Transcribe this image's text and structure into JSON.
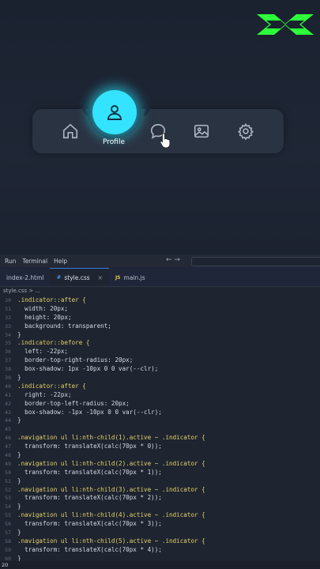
{
  "demo": {
    "nav_items": [
      {
        "name": "home",
        "label": "Home"
      },
      {
        "name": "profile",
        "label": "Profile"
      },
      {
        "name": "message",
        "label": "Message"
      },
      {
        "name": "photos",
        "label": "Photos"
      },
      {
        "name": "settings",
        "label": "Settings"
      }
    ],
    "active_label": "Profile",
    "accent_color": "#33e3ff",
    "logo_color": "#2cff3a"
  },
  "editor": {
    "menu": [
      "Run",
      "Terminal",
      "Help"
    ],
    "arrows": "←  →",
    "tabs": [
      {
        "label": "index-2.html"
      },
      {
        "label": "style.css",
        "icon": "#",
        "close": "×"
      },
      {
        "label": "main.js",
        "icon": "JS"
      }
    ],
    "breadcrumb": "style.css >  ...",
    "code_lines": [
      {
        "n": "30",
        "t": ".indicator::after {"
      },
      {
        "n": "31",
        "t": "  width: 20px;"
      },
      {
        "n": "32",
        "t": "  height: 20px;"
      },
      {
        "n": "33",
        "t": "  background: transparent;"
      },
      {
        "n": "34",
        "t": "}"
      },
      {
        "n": "35",
        "t": ".indicator::before {"
      },
      {
        "n": "36",
        "t": "  left: -22px;"
      },
      {
        "n": "37",
        "t": "  border-top-right-radius: 20px;"
      },
      {
        "n": "38",
        "t": "  box-shadow: 1px -10px 0 0 var(--clr);"
      },
      {
        "n": "39",
        "t": "}"
      },
      {
        "n": "40",
        "t": ".indicator::after {"
      },
      {
        "n": "41",
        "t": "  right: -22px;"
      },
      {
        "n": "42",
        "t": "  border-top-left-radius: 20px;"
      },
      {
        "n": "43",
        "t": "  box-shadow: -1px -10px 0 0 var(--clr);"
      },
      {
        "n": "44",
        "t": "}"
      },
      {
        "n": "45",
        "t": ""
      },
      {
        "n": "46",
        "t": ".navigation ul li:nth-child(1).active ~ .indicator {"
      },
      {
        "n": "47",
        "t": "  transform: translateX(calc(70px * 0));"
      },
      {
        "n": "48",
        "t": "}"
      },
      {
        "n": "49",
        "t": ".navigation ul li:nth-child(2).active ~ .indicator {"
      },
      {
        "n": "50",
        "t": "  transform: translateX(calc(70px * 1));"
      },
      {
        "n": "51",
        "t": "}"
      },
      {
        "n": "52",
        "t": ".navigation ul li:nth-child(3).active ~ .indicator {"
      },
      {
        "n": "53",
        "t": "  transform: translateX(calc(70px * 2));"
      },
      {
        "n": "54",
        "t": "}"
      },
      {
        "n": "55",
        "t": ".navigation ul li:nth-child(4).active ~ .indicator {"
      },
      {
        "n": "56",
        "t": "  transform: translateX(calc(70px * 3));"
      },
      {
        "n": "57",
        "t": "}"
      },
      {
        "n": "58",
        "t": ".navigation ul li:nth-child(5).active ~ .indicator {"
      },
      {
        "n": "59",
        "t": "  transform: translateX(calc(70px * 4));"
      },
      {
        "n": "60",
        "t": "}"
      }
    ],
    "status": "20"
  }
}
